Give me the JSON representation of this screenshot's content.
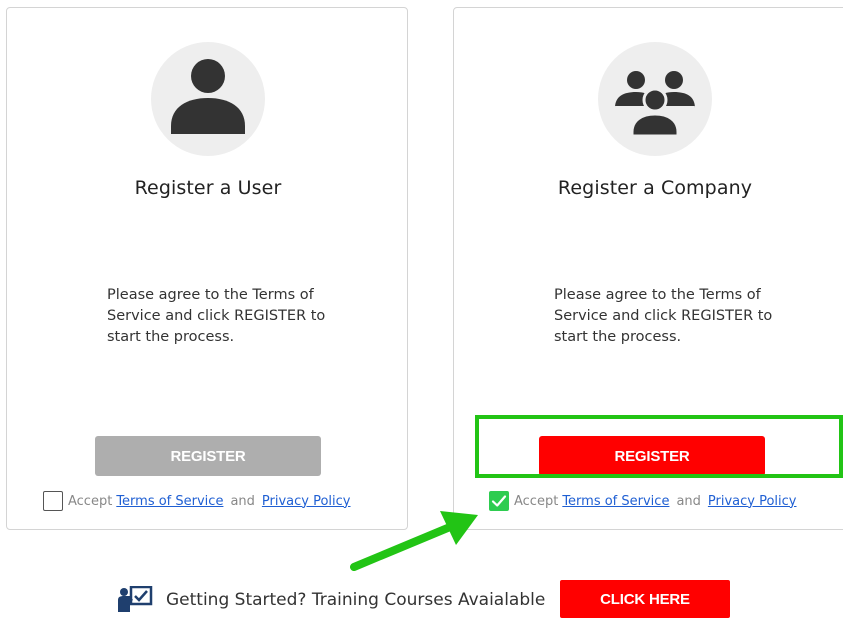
{
  "cards": {
    "user": {
      "avatar_icon": "person-icon",
      "title": "Register a User",
      "description": "Please agree to the Terms of Service and click REGISTER to start the process.",
      "register_label": "REGISTER",
      "register_state": "disabled",
      "accept_label": "Accept",
      "terms_link": "Terms of Service",
      "and_text": "and",
      "privacy_link": "Privacy Policy",
      "checked": false
    },
    "company": {
      "avatar_icon": "group-icon",
      "title": "Register a Company",
      "description": "Please agree to the Terms of Service and click REGISTER to start the process.",
      "register_label": "REGISTER",
      "register_state": "enabled",
      "accept_label": "Accept",
      "terms_link": "Terms of Service",
      "and_text": "and",
      "privacy_link": "Privacy Policy",
      "checked": true
    }
  },
  "footer": {
    "icon": "training-icon",
    "text": "Getting Started? Training Courses Avaialable",
    "button_label": "CLICK HERE"
  },
  "colors": {
    "accent_red": "#ff0000",
    "disabled_gray": "#aeaeae",
    "highlight_green": "#22c415",
    "checkbox_green": "#2ecc50",
    "link_blue": "#1f5fd3",
    "icon_dark": "#333333"
  },
  "annotations": {
    "highlight": "green-outline-box",
    "arrow": "green-arrow-icon"
  }
}
